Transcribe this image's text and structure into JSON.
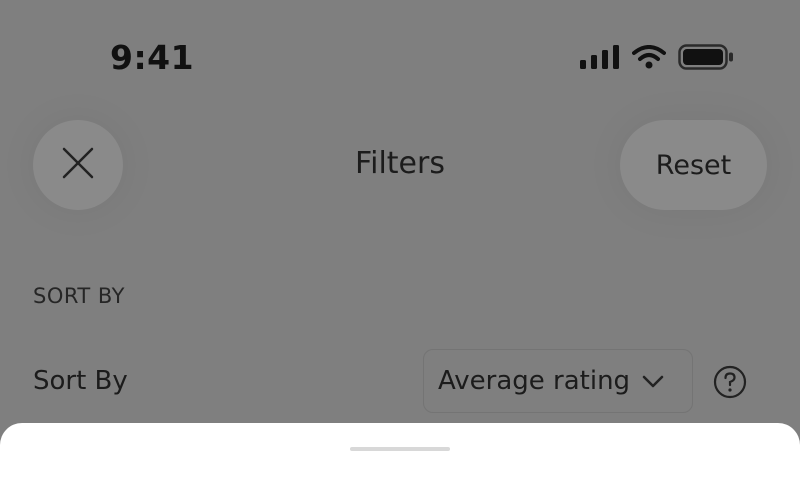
{
  "status_bar": {
    "time": "9:41",
    "icons": [
      "signal-icon",
      "wifi-icon",
      "battery-icon"
    ]
  },
  "header": {
    "title": "Filters",
    "close_icon": "close-icon",
    "reset_label": "Reset"
  },
  "sort_section": {
    "heading": "SORT BY",
    "label": "Sort By",
    "selected": "Average rating",
    "dropdown_icon": "chevron-down-icon",
    "help_icon": "help-icon"
  },
  "colors": {
    "overlay_background": "#7f7f7f",
    "sheet_background": "#ffffff"
  }
}
